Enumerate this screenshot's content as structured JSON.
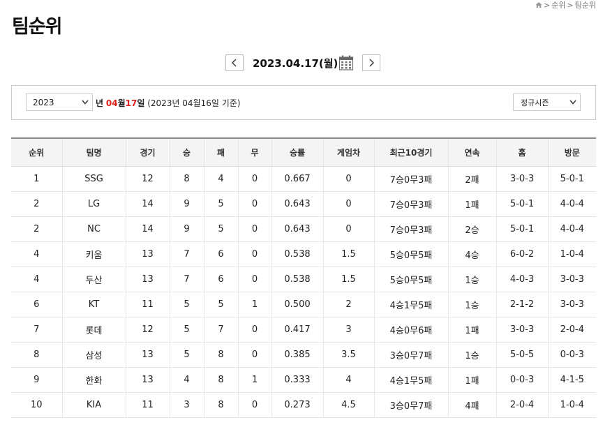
{
  "breadcrumb": {
    "items": [
      "순위",
      "팀순위"
    ],
    "separator": ">"
  },
  "page_title": "팀순위",
  "date_nav": {
    "date": "2023.04.17(월)"
  },
  "filter": {
    "year": "2023",
    "year_suffix": "년",
    "month": "04",
    "month_suffix": "월",
    "day": "17",
    "day_suffix": "일",
    "basis_note": "(2023년 04월16일 기준)",
    "season": "정규시즌"
  },
  "table": {
    "headers": [
      "순위",
      "팀명",
      "경기",
      "승",
      "패",
      "무",
      "승률",
      "게임차",
      "최근10경기",
      "연속",
      "홈",
      "방문"
    ],
    "rows": [
      [
        "1",
        "SSG",
        "12",
        "8",
        "4",
        "0",
        "0.667",
        "0",
        "7승0무3패",
        "2패",
        "3-0-3",
        "5-0-1"
      ],
      [
        "2",
        "LG",
        "14",
        "9",
        "5",
        "0",
        "0.643",
        "0",
        "7승0무3패",
        "1패",
        "5-0-1",
        "4-0-4"
      ],
      [
        "2",
        "NC",
        "14",
        "9",
        "5",
        "0",
        "0.643",
        "0",
        "7승0무3패",
        "2승",
        "5-0-1",
        "4-0-4"
      ],
      [
        "4",
        "키움",
        "13",
        "7",
        "6",
        "0",
        "0.538",
        "1.5",
        "5승0무5패",
        "4승",
        "6-0-2",
        "1-0-4"
      ],
      [
        "4",
        "두산",
        "13",
        "7",
        "6",
        "0",
        "0.538",
        "1.5",
        "5승0무5패",
        "1승",
        "4-0-3",
        "3-0-3"
      ],
      [
        "6",
        "KT",
        "11",
        "5",
        "5",
        "1",
        "0.500",
        "2",
        "4승1무5패",
        "1승",
        "2-1-2",
        "3-0-3"
      ],
      [
        "7",
        "롯데",
        "12",
        "5",
        "7",
        "0",
        "0.417",
        "3",
        "4승0무6패",
        "1패",
        "3-0-3",
        "2-0-4"
      ],
      [
        "8",
        "삼성",
        "13",
        "5",
        "8",
        "0",
        "0.385",
        "3.5",
        "3승0무7패",
        "1승",
        "5-0-5",
        "0-0-3"
      ],
      [
        "9",
        "한화",
        "13",
        "4",
        "8",
        "1",
        "0.333",
        "4",
        "4승1무5패",
        "1패",
        "0-0-3",
        "4-1-5"
      ],
      [
        "10",
        "KIA",
        "11",
        "3",
        "8",
        "0",
        "0.273",
        "4.5",
        "3승0무7패",
        "4패",
        "2-0-4",
        "1-0-4"
      ]
    ]
  },
  "colors": {
    "accent_red": "#e0201c",
    "header_bg": "#f4f4f4"
  },
  "icons": {
    "home": "home-icon",
    "prev": "chevron-left-icon",
    "next": "chevron-right-icon",
    "calendar": "calendar-icon",
    "dropdown": "chevron-down-icon"
  }
}
